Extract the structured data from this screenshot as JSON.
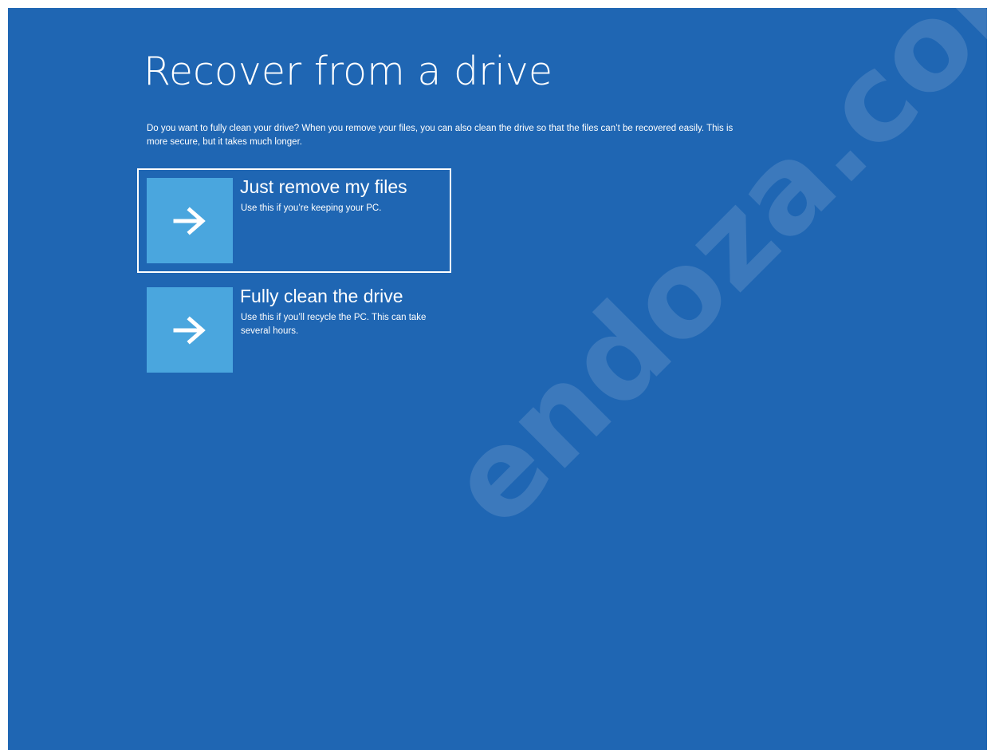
{
  "page": {
    "title": "Recover from a drive",
    "description": "Do you want to fully clean your drive? When you remove your files, you can also clean the drive so that the files can’t be recovered easily. This is more secure, but it takes much longer."
  },
  "options": [
    {
      "label": "Just remove my files",
      "description": "Use this if you’re keeping your PC.",
      "icon": "arrow-right-icon",
      "selected": true
    },
    {
      "label": "Fully clean the drive",
      "description": "Use this if you’ll recycle the PC. This can take several hours.",
      "icon": "arrow-right-icon",
      "selected": false
    }
  ],
  "watermark": "endoza.com",
  "colors": {
    "background": "#1f66b3",
    "tile": "#4aa6de",
    "text": "#ffffff",
    "selection_border": "#ffffff"
  }
}
